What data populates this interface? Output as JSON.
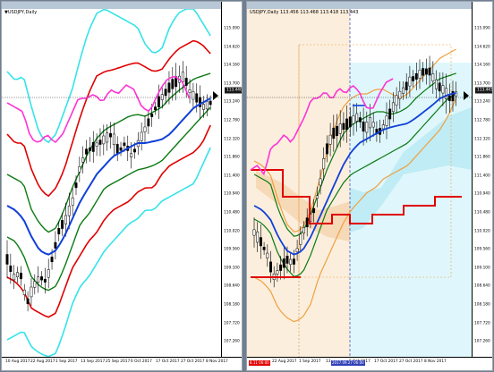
{
  "left": {
    "symbol_label": "▼USDJPY,Daily",
    "price_tag": "113.440",
    "y_ticks": [
      "115.090",
      "114.620",
      "114.160",
      "113.700",
      "113.240",
      "112.780",
      "112.320",
      "111.860",
      "111.400",
      "110.940",
      "110.480",
      "110.020",
      "109.560",
      "109.100",
      "108.640",
      "108.180",
      "107.720",
      "107.260",
      "106.800"
    ],
    "x_ticks": [
      "10 Aug 2017",
      "22 Aug 2017",
      "1 Sep 2017",
      "13 Sep 2017",
      "25 Sep 2017",
      "6 Oct 2017",
      "17 Oct 2017",
      "27 Oct 2017",
      "8 Nov 2017"
    ]
  },
  "right": {
    "symbol_label": "USDJPY,Daily  113.456 113.468 113.418 113.443",
    "price_tag": "113.443",
    "y_ticks": [
      "115.090",
      "114.620",
      "114.160",
      "113.700",
      "113.240",
      "112.780",
      "112.320",
      "111.860",
      "111.400",
      "110.940",
      "110.480",
      "110.020",
      "109.560",
      "109.100",
      "108.640",
      "108.180",
      "107.720",
      "107.260",
      "106.800"
    ],
    "x_ticks": [
      "22 Aug 2017",
      "1 Sep 2017",
      "13",
      "6 Oct 2017",
      "17 Oct 2017",
      "27 Oct 2017",
      "8 Nov 2017"
    ],
    "red_tag": "8.11 06:00",
    "blue_tag": "2017.09.27 06:00"
  }
}
